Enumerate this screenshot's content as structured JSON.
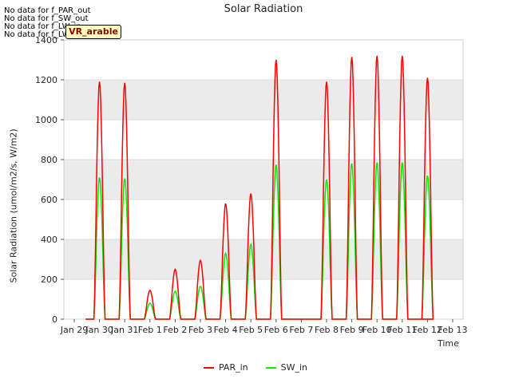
{
  "nodata_messages": [
    "No data for f_PAR_out",
    "No data for f_SW_out",
    "No data for f_LW_in",
    "No data for f_LW_out"
  ],
  "tag_label": "VR_arable",
  "colors": {
    "par": "#ff0000",
    "sw": "#00ee00",
    "band": "#ebebeb",
    "grid": "#dddddd"
  },
  "chart_data": {
    "type": "line",
    "title": "Solar Radiation",
    "xlabel": "Time",
    "ylabel": "Solar Radiation (umol/m2/s, W/m2)",
    "ylim": [
      0,
      1400
    ],
    "yticks": [
      0,
      200,
      400,
      600,
      800,
      1000,
      1200,
      1400
    ],
    "x_tick_labels": [
      "Jan 29",
      "Jan 30",
      "Jan 31",
      "Feb 1",
      "Feb 2",
      "Feb 3",
      "Feb 4",
      "Feb 5",
      "Feb 6",
      "Feb 7",
      "Feb 8",
      "Feb 9",
      "Feb 10",
      "Feb 11",
      "Feb 12",
      "Feb 13"
    ],
    "x_range": [
      "Jan 29",
      "Feb 13"
    ],
    "grid": true,
    "legend_position": "bottom-center",
    "series": [
      {
        "name": "PAR_in",
        "daily_peaks": [
          {
            "day": "Jan 30",
            "peak": 1190
          },
          {
            "day": "Jan 31",
            "peak": 1185
          },
          {
            "day": "Feb 1",
            "peak": 145
          },
          {
            "day": "Feb 2",
            "peak": 250
          },
          {
            "day": "Feb 3",
            "peak": 295
          },
          {
            "day": "Feb 4",
            "peak": 580
          },
          {
            "day": "Feb 5",
            "peak": 630
          },
          {
            "day": "Feb 6",
            "peak": 1300
          },
          {
            "day": "Feb 7",
            "peak": 0
          },
          {
            "day": "Feb 8",
            "peak": 1190
          },
          {
            "day": "Feb 9",
            "peak": 1315
          },
          {
            "day": "Feb 10",
            "peak": 1320
          },
          {
            "day": "Feb 11",
            "peak": 1320
          },
          {
            "day": "Feb 12",
            "peak": 1210
          }
        ]
      },
      {
        "name": "SW_in",
        "daily_peaks": [
          {
            "day": "Jan 30",
            "peak": 710
          },
          {
            "day": "Jan 31",
            "peak": 705
          },
          {
            "day": "Feb 1",
            "peak": 80
          },
          {
            "day": "Feb 2",
            "peak": 140
          },
          {
            "day": "Feb 3",
            "peak": 165
          },
          {
            "day": "Feb 4",
            "peak": 330
          },
          {
            "day": "Feb 5",
            "peak": 375
          },
          {
            "day": "Feb 6",
            "peak": 775
          },
          {
            "day": "Feb 7",
            "peak": 0
          },
          {
            "day": "Feb 8",
            "peak": 700
          },
          {
            "day": "Feb 9",
            "peak": 780
          },
          {
            "day": "Feb 10",
            "peak": 785
          },
          {
            "day": "Feb 11",
            "peak": 785
          },
          {
            "day": "Feb 12",
            "peak": 720
          }
        ]
      }
    ]
  }
}
